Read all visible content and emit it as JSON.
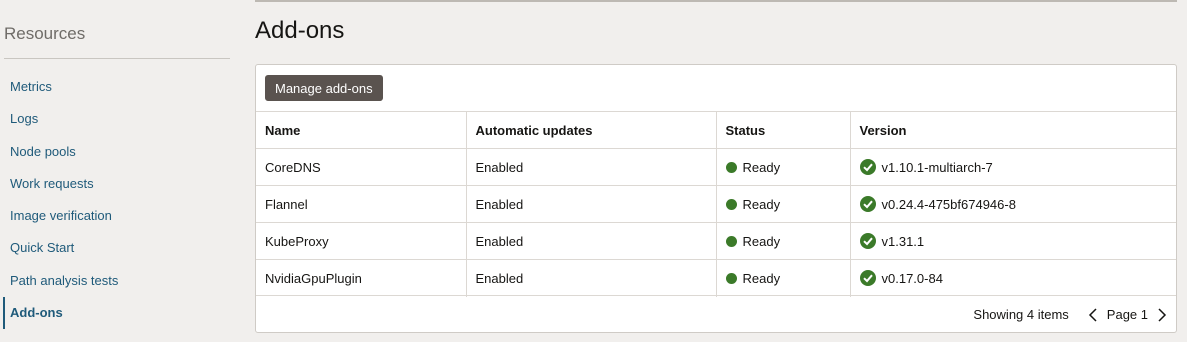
{
  "sidebar": {
    "title": "Resources",
    "items": [
      {
        "label": "Metrics"
      },
      {
        "label": "Logs"
      },
      {
        "label": "Node pools"
      },
      {
        "label": "Work requests"
      },
      {
        "label": "Image verification"
      },
      {
        "label": "Quick Start"
      },
      {
        "label": "Path analysis tests"
      },
      {
        "label": "Add-ons",
        "active": true
      }
    ]
  },
  "main": {
    "title": "Add-ons",
    "manage_button_label": "Manage add-ons",
    "table": {
      "columns": [
        "Name",
        "Automatic updates",
        "Status",
        "Version"
      ],
      "rows": [
        {
          "name": "CoreDNS",
          "auto_updates": "Enabled",
          "status": "Ready",
          "version": "v1.10.1-multiarch-7"
        },
        {
          "name": "Flannel",
          "auto_updates": "Enabled",
          "status": "Ready",
          "version": "v0.24.4-475bf674946-8"
        },
        {
          "name": "KubeProxy",
          "auto_updates": "Enabled",
          "status": "Ready",
          "version": "v1.31.1"
        },
        {
          "name": "NvidiaGpuPlugin",
          "auto_updates": "Enabled",
          "status": "Ready",
          "version": "v0.17.0-84"
        }
      ]
    },
    "footer": {
      "showing": "Showing 4 items",
      "page": "Page 1"
    }
  },
  "colors": {
    "accent": "#1f5a7a",
    "status_ok": "#3b7a29",
    "button_bg": "#5a534f"
  }
}
